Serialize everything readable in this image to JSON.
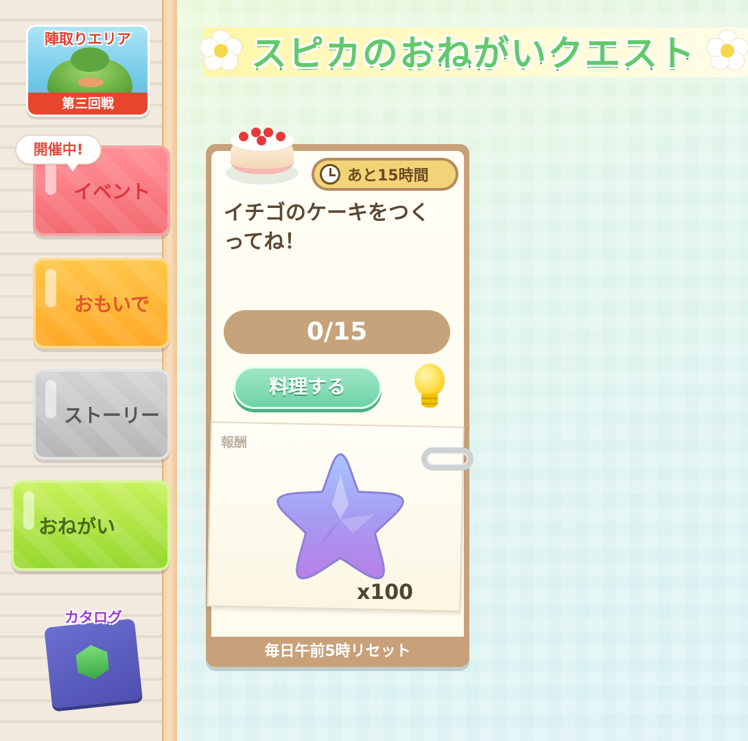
{
  "sidebar": {
    "area_card": {
      "title": "陣取りエリア",
      "round": "第三回戦"
    },
    "event_badge": "開催中!",
    "menu": [
      {
        "id": "event",
        "label": "イベント"
      },
      {
        "id": "omoide",
        "label": "おもいで"
      },
      {
        "id": "story",
        "label": "ストーリー"
      },
      {
        "id": "onegai",
        "label": "おねがい"
      }
    ],
    "catalog": {
      "label": "カタログ",
      "icon": "book-icon"
    }
  },
  "header": {
    "title": "スピカのおねがいクエスト",
    "decoration_icon": "daisy-flower-icon"
  },
  "quest": {
    "icon": "strawberry-cake-icon",
    "timer": {
      "icon": "clock-icon",
      "text": "あと15時間"
    },
    "description": "イチゴのケーキをつくってね！",
    "progress": {
      "current": 0,
      "total": 15,
      "text": "0/15"
    },
    "action_button": "料理する",
    "hint_icon": "lightbulb-icon",
    "reward": {
      "label": "報酬",
      "icon": "purple-star-icon",
      "amount": "x100"
    },
    "footer": "毎日午前5時リセット"
  },
  "colors": {
    "title_green": "#62c96c",
    "event_red": "#f36b72",
    "omoide_orange": "#ffa927",
    "story_gray": "#b5b5b5",
    "onegai_green": "#96d830",
    "card_brown": "#c8a17a",
    "cook_green": "#6fd2a6"
  }
}
